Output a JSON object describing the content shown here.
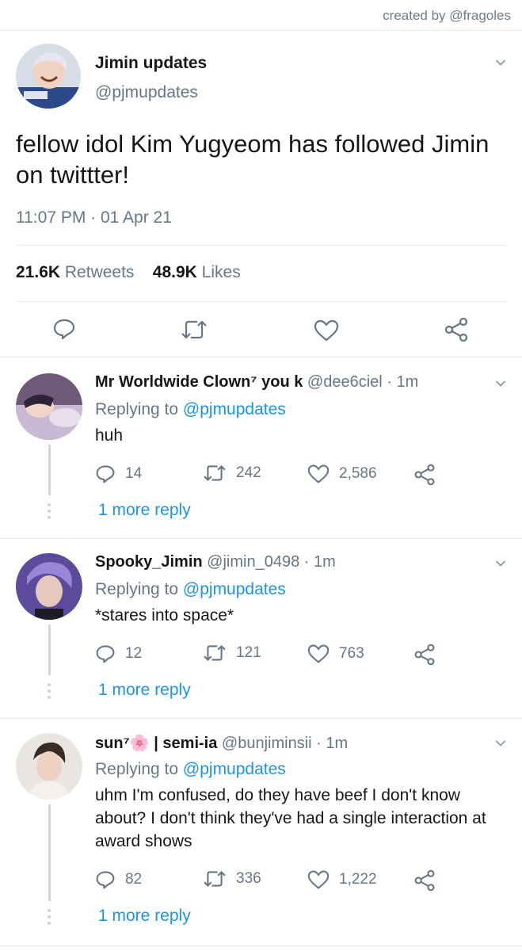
{
  "credit": "created by @fragoles",
  "main_tweet": {
    "name": "Jimin updates",
    "handle": "@pjmupdates",
    "text": "fellow idol Kim Yugyeom has followed Jimin on twittter!",
    "timestamp": "11:07 PM · 01 Apr 21",
    "retweets_count": "21.6K",
    "retweets_label": "Retweets",
    "likes_count": "48.9K",
    "likes_label": "Likes"
  },
  "replies": [
    {
      "name": "Mr Worldwide Clown⁷ you k",
      "handle": "@dee6ciel · 1m",
      "replying_prefix": "Replying to ",
      "replying_to": "@pjmupdates",
      "text": "huh",
      "reply_count": "14",
      "retweet_count": "242",
      "like_count": "2,586",
      "more_replies": "1 more reply"
    },
    {
      "name": "Spooky_Jimin",
      "handle": "@jimin_0498 · 1m",
      "replying_prefix": "Replying to ",
      "replying_to": "@pjmupdates",
      "text": "*stares into space*",
      "reply_count": "12",
      "retweet_count": "121",
      "like_count": "763",
      "more_replies": "1 more reply"
    },
    {
      "name": "sun⁷🌸 | semi-ia",
      "handle": "@bunjiminsii · 1m",
      "replying_prefix": "Replying to ",
      "replying_to": "@pjmupdates",
      "text": "uhm I'm confused, do they have beef I don't know about? I don't think they've had a single interaction at award shows",
      "reply_count": "82",
      "retweet_count": "336",
      "like_count": "1,222",
      "more_replies": "1 more reply"
    }
  ],
  "icons": {
    "reply": "comment-bubble-icon",
    "retweet": "retweet-icon",
    "like": "heart-icon",
    "share": "share-icon",
    "menu": "chevron-down-icon"
  },
  "colors": {
    "link": "#1b95e0",
    "secondary_text": "#657786",
    "divider": "#e6ecf0"
  }
}
